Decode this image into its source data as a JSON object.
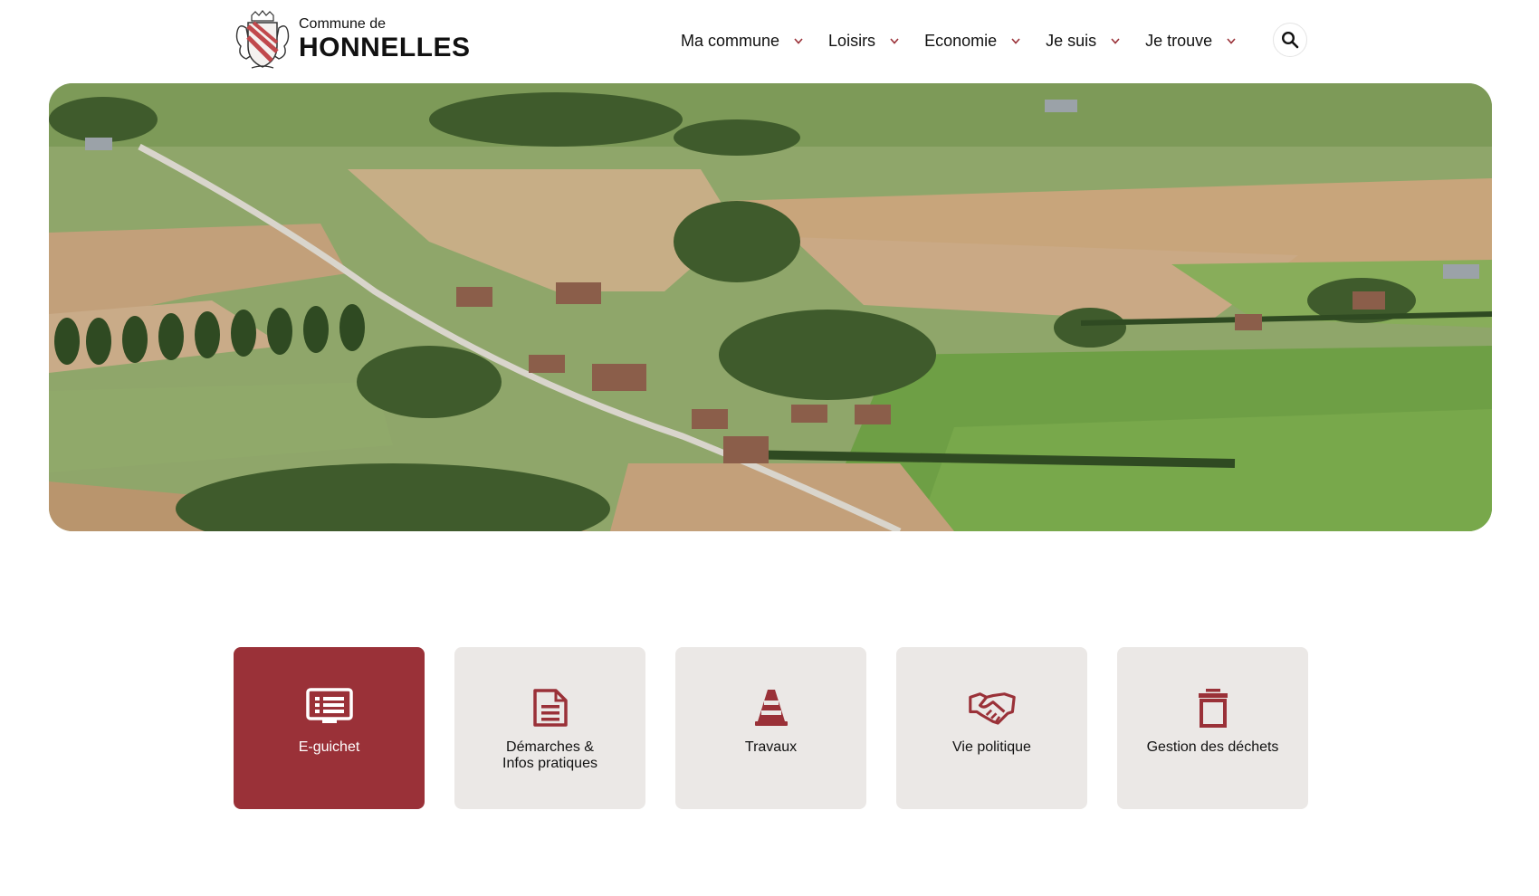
{
  "header": {
    "logo": {
      "line1": "Commune de",
      "line2": "HONNELLES"
    },
    "nav": [
      {
        "label": "Ma commune"
      },
      {
        "label": "Loisirs"
      },
      {
        "label": "Economie"
      },
      {
        "label": "Je suis"
      },
      {
        "label": "Je trouve"
      }
    ],
    "search_icon": "search-icon"
  },
  "hero": {
    "image": "aerial-countryside-village"
  },
  "tiles": [
    {
      "label": "E-guichet",
      "icon": "monitor-list-icon",
      "active": true
    },
    {
      "label": "Démarches &\nInfos pratiques",
      "icon": "document-icon",
      "active": false
    },
    {
      "label": "Travaux",
      "icon": "traffic-cone-icon",
      "active": false
    },
    {
      "label": "Vie politique",
      "icon": "handshake-icon",
      "active": false
    },
    {
      "label": "Gestion des déchets",
      "icon": "trash-bin-icon",
      "active": false
    }
  ],
  "colors": {
    "accent": "#9a3138",
    "tile_bg": "#ebe8e6",
    "text": "#111111"
  }
}
